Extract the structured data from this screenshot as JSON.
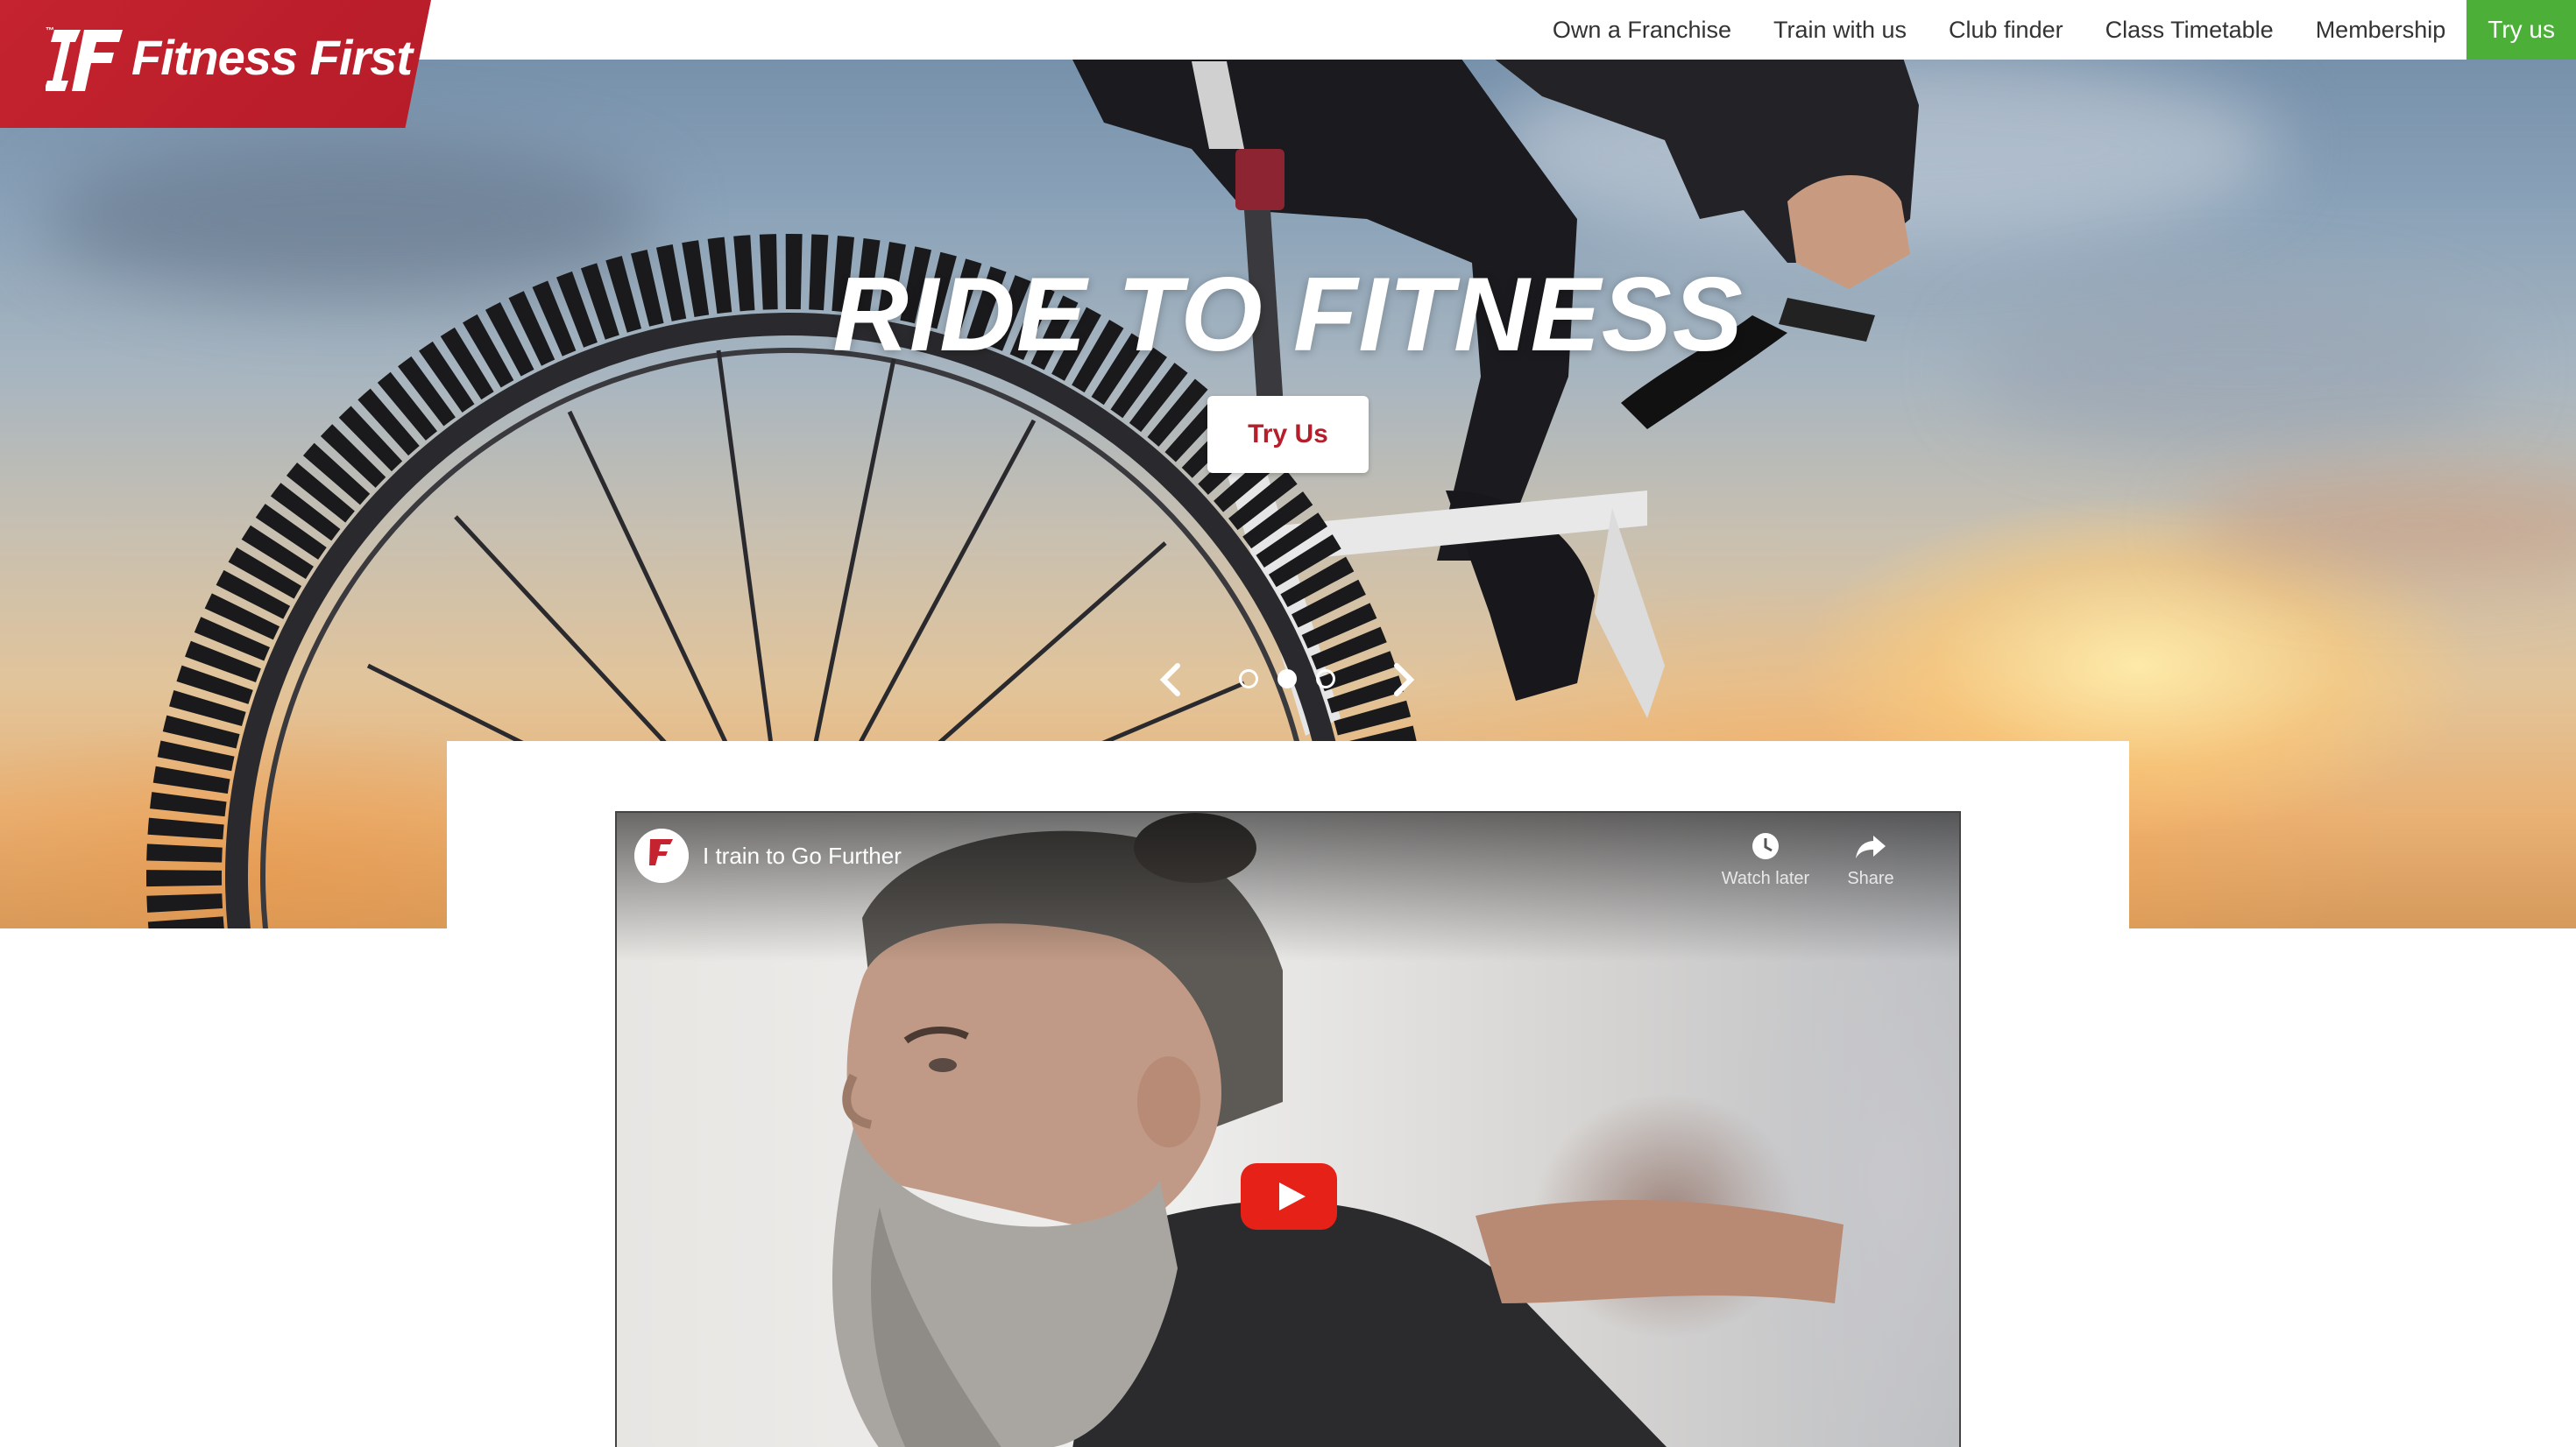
{
  "brand": {
    "logo_text": "Fitness First",
    "logo_mark": "IF",
    "colors": {
      "brand_red": "#b61c28",
      "cta_green": "#4caf38",
      "nav_text": "#333333"
    }
  },
  "nav": {
    "items": [
      {
        "label": "Own a Franchise"
      },
      {
        "label": "Train with us"
      },
      {
        "label": "Club finder"
      },
      {
        "label": "Class Timetable"
      },
      {
        "label": "Membership"
      }
    ],
    "cta_label": "Try us"
  },
  "hero": {
    "title": "RIDE TO FITNESS",
    "button_label": "Try Us",
    "carousel": {
      "slide_count": 3,
      "active_index": 1,
      "prev_icon": "chevron-left-icon",
      "next_icon": "chevron-right-icon"
    }
  },
  "video": {
    "title": "I train to Go Further",
    "channel_avatar_text": "Fitness First",
    "actions": [
      {
        "label": "Watch later",
        "icon": "clock-icon"
      },
      {
        "label": "Share",
        "icon": "share-icon"
      }
    ],
    "play_icon": "play-icon"
  }
}
